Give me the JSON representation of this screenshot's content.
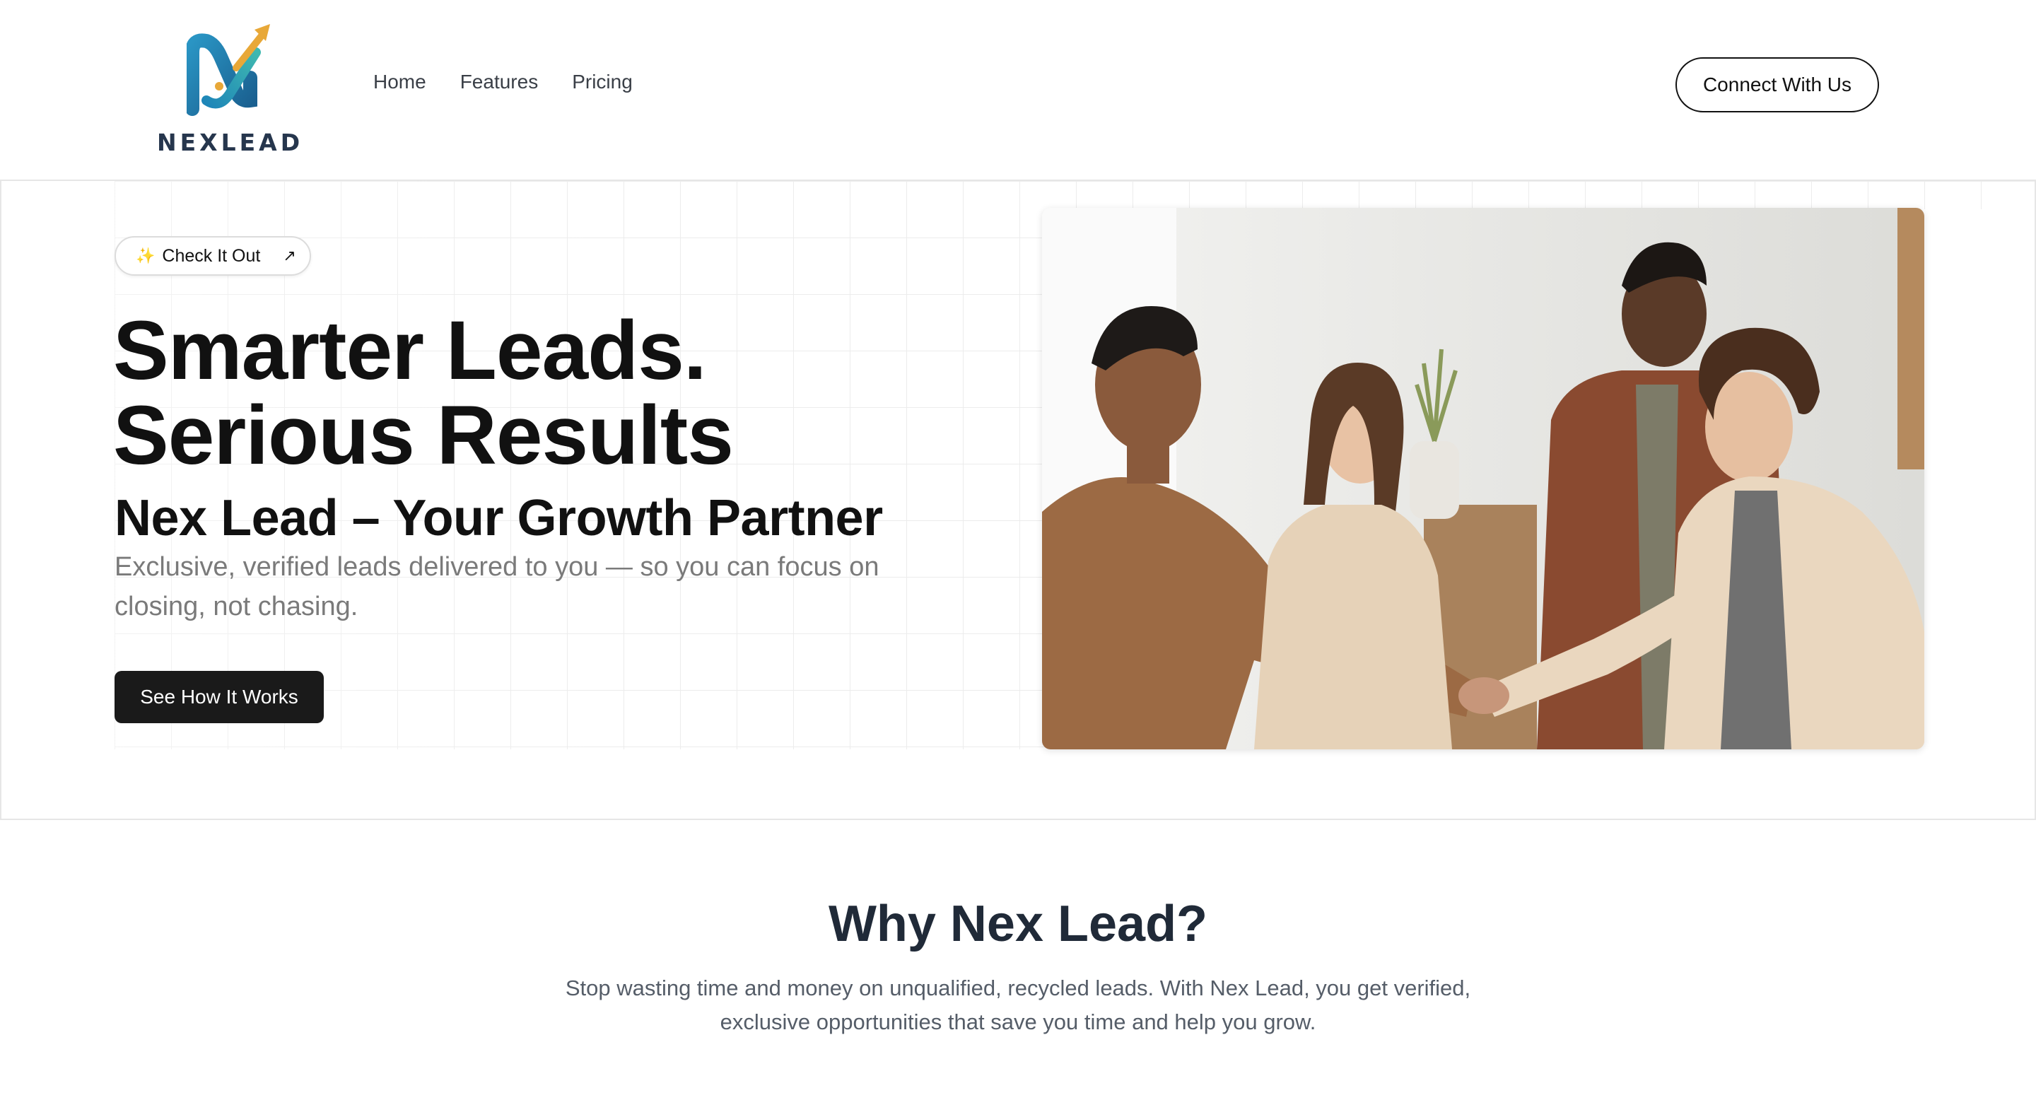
{
  "brand": {
    "name": "NEXLEAD"
  },
  "nav": {
    "items": [
      "Home",
      "Features",
      "Pricing"
    ]
  },
  "header": {
    "cta_label": "Connect With Us"
  },
  "hero": {
    "pill_label": "Check It Out",
    "headline_line1": "Smarter Leads.",
    "headline_line2": "Serious Results",
    "subheadline": "Nex Lead – Your Growth Partner",
    "description": "Exclusive, verified leads delivered to you — so you can focus on closing, not chasing.",
    "cta_label": "See How It Works"
  },
  "why": {
    "title": "Why Nex Lead?",
    "text": "Stop wasting time and money on unqualified, recycled leads. With Nex Lead, you get verified, exclusive opportunities that save you time and help you grow."
  },
  "colors": {
    "accent_dark": "#1a1a1a",
    "logo_blue": "#1f7fb0",
    "logo_gold": "#e8a838",
    "heading": "#202a38"
  }
}
